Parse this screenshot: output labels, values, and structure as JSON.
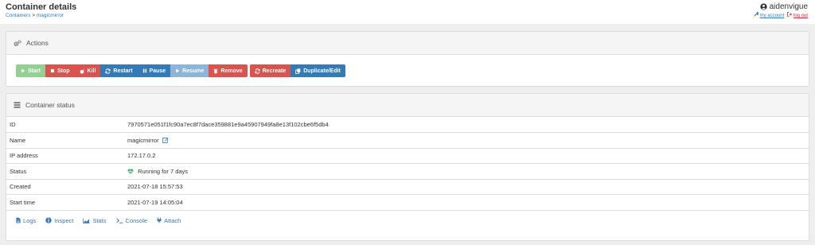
{
  "header": {
    "title": "Container details",
    "breadcrumb": {
      "parent": "Containers",
      "separator": ">",
      "current": "magicmirror"
    },
    "user": {
      "name": "aidenvigue",
      "my_account": "my account",
      "log_out": "log out"
    }
  },
  "actions": {
    "heading": "Actions",
    "buttons": {
      "start": "Start",
      "stop": "Stop",
      "kill": "Kill",
      "restart": "Restart",
      "pause": "Pause",
      "resume": "Resume",
      "remove": "Remove",
      "recreate": "Recreate",
      "duplicate": "Duplicate/Edit"
    }
  },
  "status": {
    "heading": "Container status",
    "rows": {
      "id": {
        "label": "ID",
        "value": "7970571e051f1fc90a7ec8f7dace359881e9a45907949fa8e13f102cbe6f5db4"
      },
      "name": {
        "label": "Name",
        "value": "magicmirror"
      },
      "ip": {
        "label": "IP address",
        "value": "172.17.0.2"
      },
      "status": {
        "label": "Status",
        "value": "Running for 7 days"
      },
      "created": {
        "label": "Created",
        "value": "2021-07-18 15:57:53"
      },
      "start_time": {
        "label": "Start time",
        "value": "2021-07-19 14:05:04"
      }
    },
    "links": {
      "logs": "Logs",
      "inspect": "Inspect",
      "stats": "Stats",
      "console": "Console",
      "attach": "Attach"
    }
  },
  "colors": {
    "link": "#337ab7",
    "danger": "#d9534f",
    "success": "#5cb85c",
    "running": "#4caf7a"
  }
}
